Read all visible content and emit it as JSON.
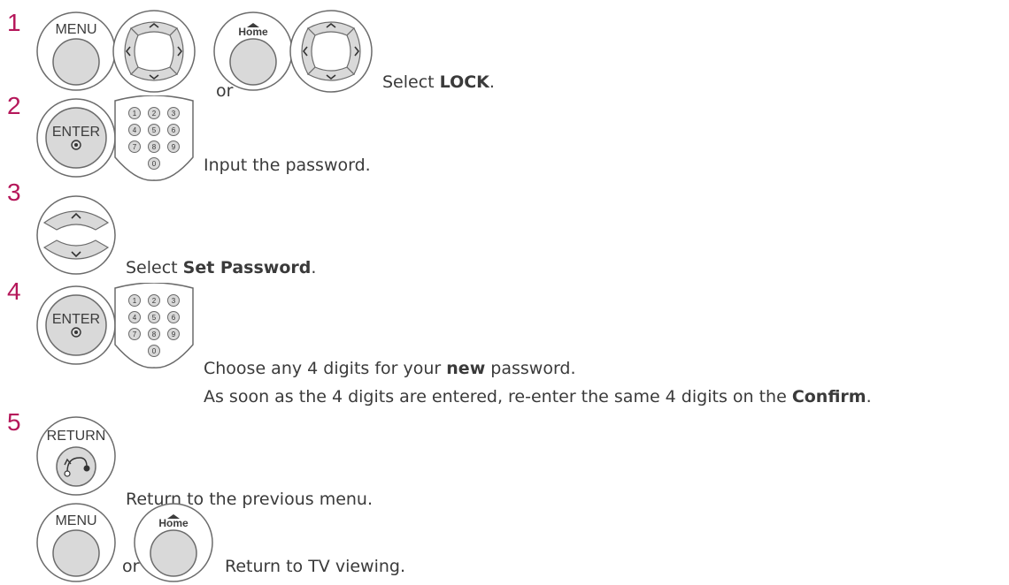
{
  "steps": [
    {
      "num": "1",
      "or": "or",
      "pre": "Select ",
      "bold": "LOCK",
      "post": "."
    },
    {
      "num": "2",
      "text": "Input the password."
    },
    {
      "num": "3",
      "pre": "Select ",
      "bold": "Set Password",
      "post": "."
    },
    {
      "num": "4",
      "line1_pre": "Choose any 4 digits for your ",
      "line1_bold": "new",
      "line1_post": " password.",
      "line2_pre": "As soon as the 4 digits are entered, re-enter the same 4 digits on the ",
      "line2_bold": "Confirm",
      "line2_post": "."
    },
    {
      "num": "5",
      "text1": "Return to the previous menu.",
      "or": "or",
      "text2": "Return to TV viewing."
    }
  ],
  "buttons": {
    "menu": "MENU",
    "home": "Home",
    "enter": "ENTER",
    "return": "RETURN",
    "keypad": [
      "1",
      "2",
      "3",
      "4",
      "5",
      "6",
      "7",
      "8",
      "9",
      "0"
    ]
  },
  "colors": {
    "step_number": "#b5175a",
    "button_fill": "#d9d9d9",
    "outline": "#6b6b6b"
  }
}
